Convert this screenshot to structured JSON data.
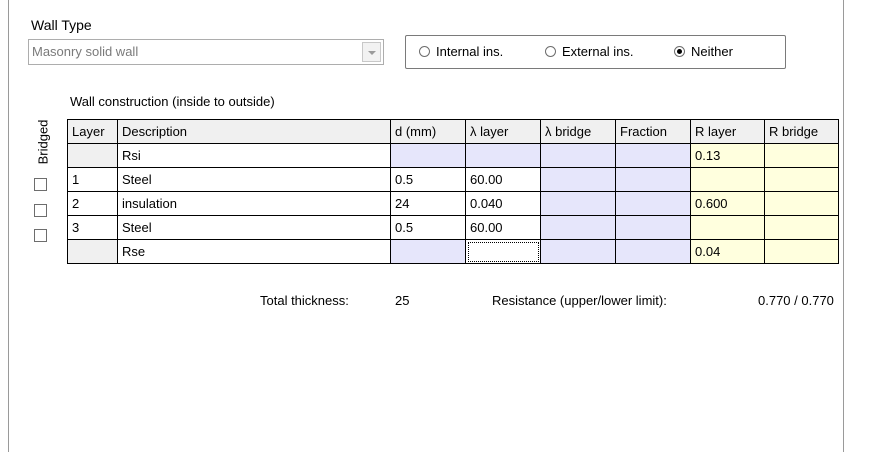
{
  "wall_type": {
    "label": "Wall Type",
    "selected": "Masonry solid wall"
  },
  "insulation_options": {
    "internal": "Internal ins.",
    "external": "External ins.",
    "neither": "Neither",
    "selected": "neither"
  },
  "construction": {
    "title": "Wall construction (inside to outside)",
    "bridged_label": "Bridged",
    "columns": [
      "Layer",
      "Description",
      "d (mm)",
      "λ layer",
      "λ bridge",
      "Fraction",
      "R layer",
      "R bridge"
    ],
    "rows": [
      {
        "layer": "",
        "description": "Rsi",
        "d": "",
        "lambda_layer": "",
        "lambda_bridge": "",
        "fraction": "",
        "r_layer": "0.13",
        "r_bridge": ""
      },
      {
        "layer": "1",
        "description": "Steel",
        "d": "0.5",
        "lambda_layer": "60.00",
        "lambda_bridge": "",
        "fraction": "",
        "r_layer": "",
        "r_bridge": ""
      },
      {
        "layer": "2",
        "description": "insulation",
        "d": "24",
        "lambda_layer": "0.040",
        "lambda_bridge": "",
        "fraction": "",
        "r_layer": "0.600",
        "r_bridge": ""
      },
      {
        "layer": "3",
        "description": "Steel",
        "d": "0.5",
        "lambda_layer": "60.00",
        "lambda_bridge": "",
        "fraction": "",
        "r_layer": "",
        "r_bridge": ""
      },
      {
        "layer": "",
        "description": "Rse",
        "d": "",
        "lambda_layer": "",
        "lambda_bridge": "",
        "fraction": "",
        "r_layer": "0.04",
        "r_bridge": ""
      }
    ]
  },
  "totals": {
    "thickness_label": "Total thickness:",
    "thickness_value": "25",
    "resistance_label": "Resistance (upper/lower limit):",
    "resistance_value": "0.770 / 0.770"
  },
  "colors": {
    "input_cell": "#e6e6fb",
    "result_cell": "#ffffde"
  }
}
